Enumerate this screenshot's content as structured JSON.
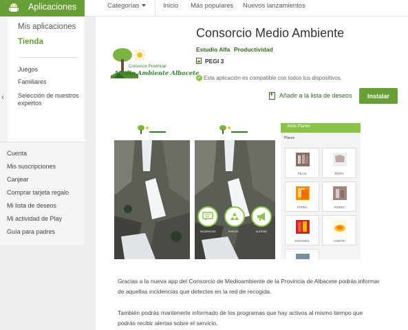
{
  "header": {
    "brand_label": "Aplicaciones",
    "nav": {
      "categories": "Categorías",
      "home": "Inicio",
      "popular": "Más populares",
      "new_releases": "Nuevos lanzamientos"
    }
  },
  "sidebar": {
    "my_apps": "Mis aplicaciones",
    "store": "Tienda",
    "items": [
      "Juegos",
      "Familiares",
      "Selección de nuestros expertos"
    ],
    "account_items": [
      "Cuenta",
      "Mis suscripciones",
      "Canjear",
      "Comprar tarjeta regalo",
      "Mi lista de deseos",
      "Mi actividad de Play",
      "Guía para padres"
    ]
  },
  "app": {
    "title": "Consorcio Medio Ambiente",
    "developer": "Estudio Alfa",
    "category": "Productividad",
    "rating": "PEGI 3",
    "compat_note": "Esta aplicación es compatible con todos tus dispositivos.",
    "wishlist_label": "Añadir a la lista de deseos",
    "install_label": "Instalar",
    "logo_text_small": "Consorcio Provincial",
    "logo_text_big": "Medio Ambiente Albacete"
  },
  "screenshots": {
    "logo_caption": "Consorcio Provincial · Medio Ambiente Albacete",
    "buttons": [
      "INCIDENCIAS",
      "PUNTOS",
      "ALERTAS"
    ],
    "third": {
      "bar_label": "Atrás    Planes",
      "subtitle": "Planes",
      "tiles": [
        "PILAS",
        "ROPA",
        "PAPEL",
        "VIDRIO",
        "ENVASES",
        "ACEITE"
      ]
    }
  },
  "description": {
    "para1_line1": "Gracias a la nueva app del Consorcio de Medioambiente de la Provincia de Albacete podrás informar",
    "para1_line2": "de aquellas incidencias que detectes en la red de recogida.",
    "para2_line1": "También podrás mantenerte informado de los programas que hay activos al mismo tiempo que",
    "para2_line2": "podrás recibir alertas sobre el servicio."
  },
  "colors": {
    "brand_green": "#689f38",
    "dark_green": "#33691e",
    "accent_green": "#8bc34a"
  }
}
